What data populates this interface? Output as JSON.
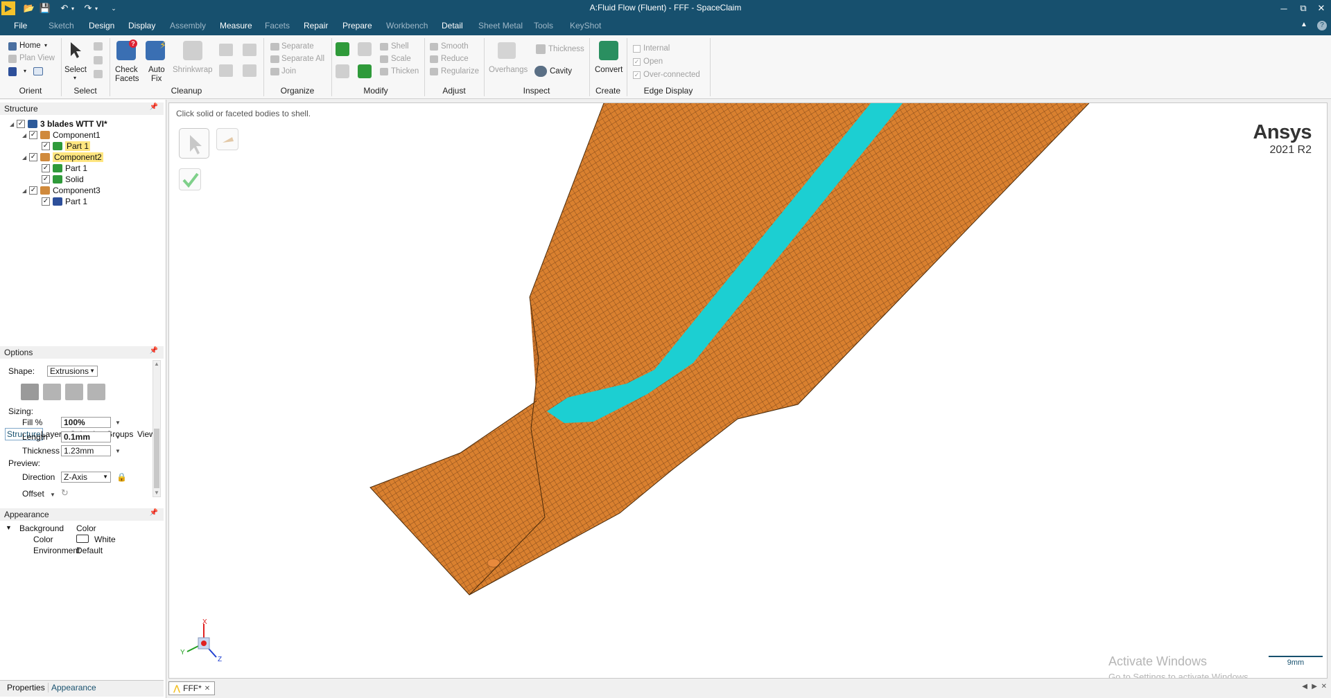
{
  "window": {
    "title": "A:Fluid Flow (Fluent) - FFF - SpaceClaim",
    "controls": {
      "minimize": "─",
      "restore": "⧉",
      "close": "✕"
    },
    "help": "?"
  },
  "menu": {
    "tabs": [
      {
        "label": "File",
        "dim": false
      },
      {
        "label": "Sketch",
        "dim": true
      },
      {
        "label": "Design",
        "dim": false
      },
      {
        "label": "Display",
        "dim": false
      },
      {
        "label": "Assembly",
        "dim": true
      },
      {
        "label": "Measure",
        "dim": false
      },
      {
        "label": "Facets",
        "dim": true
      },
      {
        "label": "Repair",
        "dim": false
      },
      {
        "label": "Prepare",
        "dim": false
      },
      {
        "label": "Workbench",
        "dim": true
      },
      {
        "label": "Detail",
        "dim": false
      },
      {
        "label": "Sheet Metal",
        "dim": true
      },
      {
        "label": "Tools",
        "dim": true
      },
      {
        "label": "KeyShot",
        "dim": true
      }
    ]
  },
  "ribbon": {
    "orient": {
      "label": "Orient",
      "home": "Home",
      "plan_view": "Plan View"
    },
    "select": {
      "label": "Select",
      "select_btn": "Select"
    },
    "cleanup": {
      "label": "Cleanup",
      "check_facets": "Check",
      "check_facets2": "Facets",
      "auto_fix": "Auto",
      "auto_fix2": "Fix",
      "shrinkwrap": "Shrinkwrap"
    },
    "organize": {
      "label": "Organize",
      "separate": "Separate",
      "separate_all": "Separate All",
      "join": "Join"
    },
    "modify": {
      "label": "Modify",
      "shell": "Shell",
      "scale": "Scale",
      "thicken": "Thicken"
    },
    "adjust": {
      "label": "Adjust",
      "smooth": "Smooth",
      "reduce": "Reduce",
      "regularize": "Regularize"
    },
    "inspect": {
      "label": "Inspect",
      "overhangs": "Overhangs",
      "thickness": "Thickness",
      "cavity": "Cavity"
    },
    "create": {
      "label": "Create",
      "convert": "Convert"
    },
    "edge_display": {
      "label": "Edge Display",
      "internal": "Internal",
      "open": "Open",
      "over_connected": "Over-connected"
    }
  },
  "structure": {
    "header": "Structure",
    "tree": [
      {
        "label": "3 blades WTT VI*",
        "level": 0,
        "bold": true,
        "icon": "assembly-icon",
        "highlight": false
      },
      {
        "label": "Component1",
        "level": 1,
        "bold": false,
        "icon": "component-icon",
        "highlight": false
      },
      {
        "label": "Part 1",
        "level": 2,
        "bold": false,
        "icon": "facet-body-icon",
        "highlight": true
      },
      {
        "label": "Component2",
        "level": 1,
        "bold": false,
        "icon": "component-icon",
        "highlight": true
      },
      {
        "label": "Part 1",
        "level": 2,
        "bold": false,
        "icon": "facet-body-icon",
        "highlight": false
      },
      {
        "label": "Solid",
        "level": 2,
        "bold": false,
        "icon": "facet-body-icon",
        "highlight": false
      },
      {
        "label": "Component3",
        "level": 1,
        "bold": false,
        "icon": "component-icon",
        "highlight": false
      },
      {
        "label": "Part 1",
        "level": 2,
        "bold": false,
        "icon": "solid-body-icon",
        "highlight": false
      }
    ],
    "tabs": [
      "Structure",
      "Layers",
      "Selection",
      "Groups",
      "Views"
    ]
  },
  "options": {
    "header": "Options",
    "shape_label": "Shape:",
    "shape_value": "Extrusions",
    "sizing_label": "Sizing:",
    "fill_label": "Fill %",
    "fill_value": "100%",
    "length_label": "Length",
    "length_value": "0.1mm",
    "thickness_label": "Thickness",
    "thickness_value": "1.23mm",
    "preview_label": "Preview:",
    "direction_label": "Direction",
    "direction_value": "Z-Axis",
    "offset_label": "Offset"
  },
  "appearance": {
    "header": "Appearance",
    "background_label": "Background",
    "background_value": "Color",
    "color_label": "Color",
    "color_value": "White",
    "environment_label": "Environment",
    "environment_value": "Default"
  },
  "bottom_tabs": [
    "Properties",
    "Appearance"
  ],
  "viewport": {
    "hint": "Click solid or faceted bodies to shell.",
    "brand_name": "Ansys",
    "brand_version": "2021 R2",
    "watermark_line1": "Activate Windows",
    "watermark_line2": "Go to Settings to activate Windows.",
    "scale_label": "9mm",
    "axes": {
      "x": "X",
      "y": "Y",
      "z": "Z"
    }
  },
  "document_tab": {
    "label": "FFF*",
    "close": "✕"
  },
  "colors": {
    "titlebar": "#17506e",
    "mesh_body": "#d9802f",
    "mesh_wire": "#6b3a14",
    "fluid_channel": "#1ccfd2"
  }
}
